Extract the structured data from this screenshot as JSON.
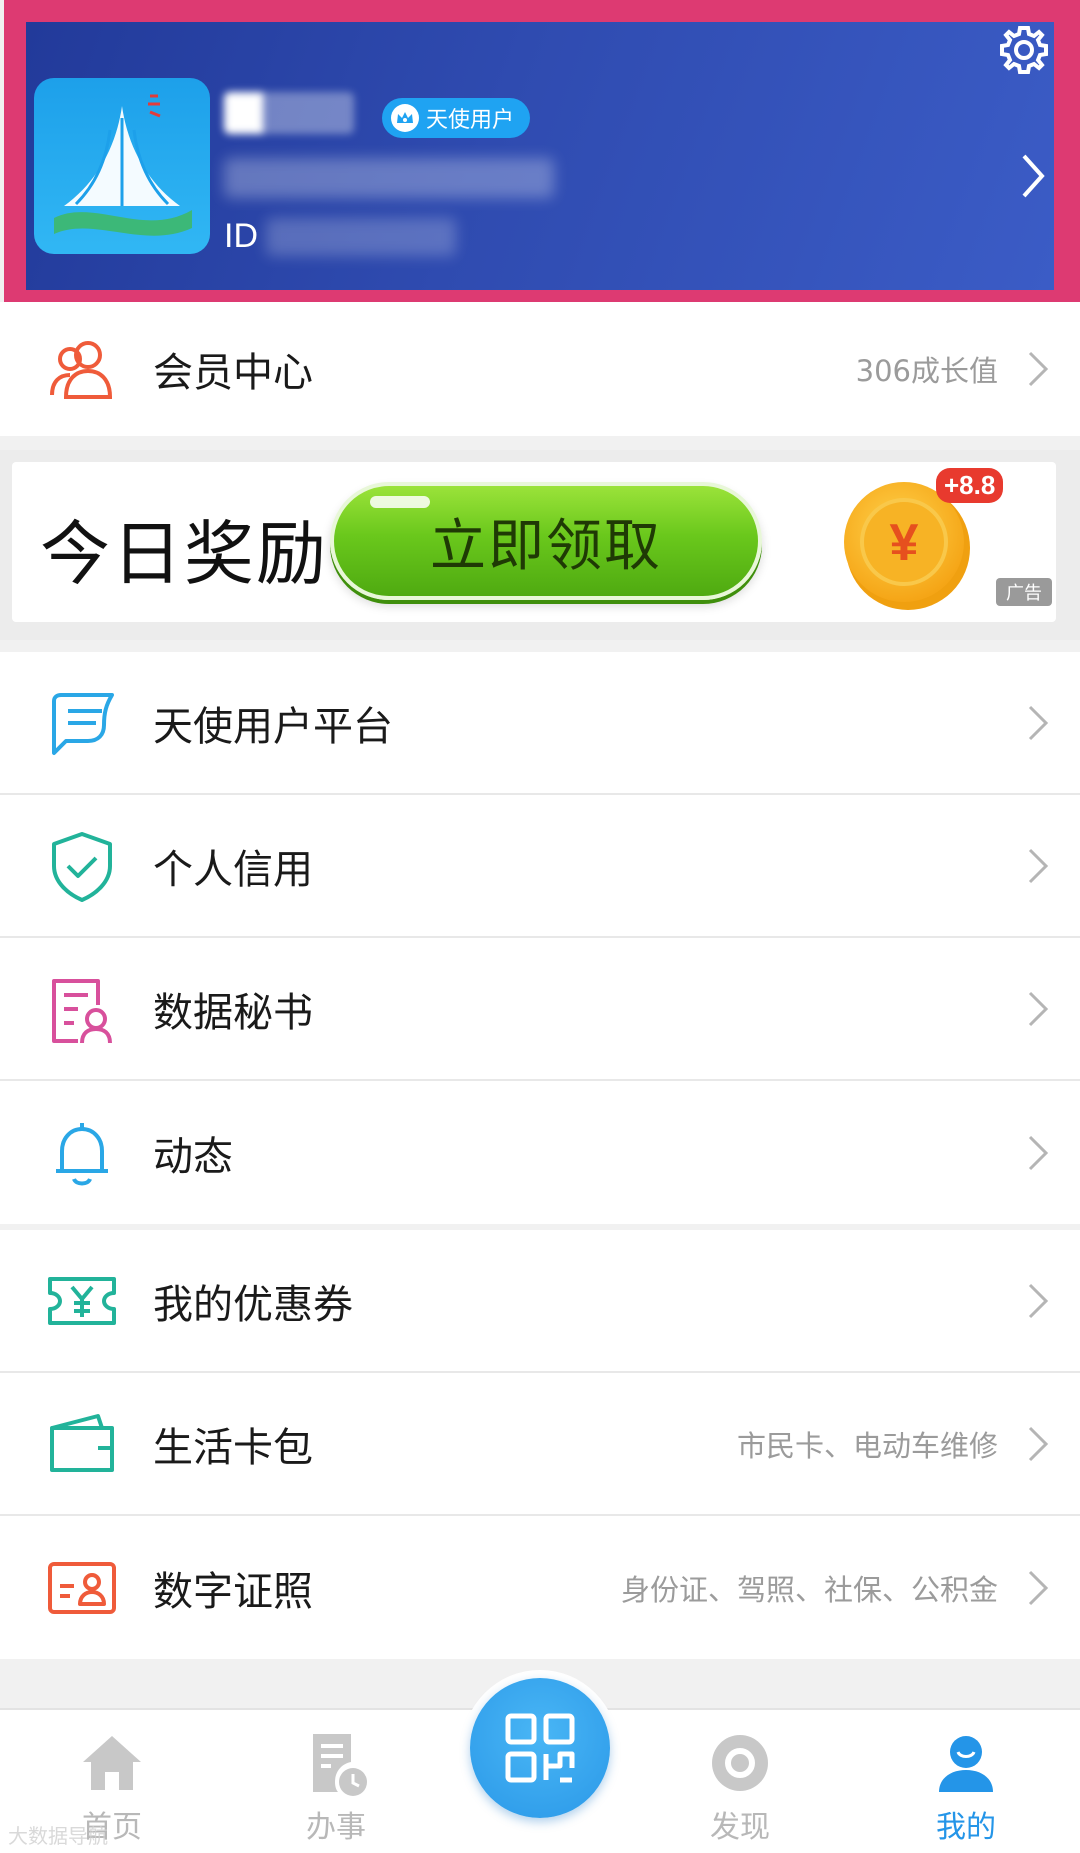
{
  "profile": {
    "badge_label": "天使用户",
    "id_label": "ID"
  },
  "member_center": {
    "label": "会员中心",
    "hint": "306成长值"
  },
  "ad": {
    "title": "今日奖励",
    "button_label": "立即领取",
    "coin_symbol": "¥",
    "coin_bonus": "+8.8",
    "tag": "广告"
  },
  "menu_group_1": [
    {
      "label": "天使用户平台",
      "icon": "chat-bubble-icon",
      "color": "#2aa7e6"
    },
    {
      "label": "个人信用",
      "icon": "shield-check-icon",
      "color": "#22b39a"
    },
    {
      "label": "数据秘书",
      "icon": "document-user-icon",
      "color": "#d8509c"
    },
    {
      "label": "动态",
      "icon": "bell-icon",
      "color": "#2aa7e6"
    }
  ],
  "menu_group_2": [
    {
      "label": "我的优惠券",
      "hint": "",
      "icon": "coupon-icon",
      "color": "#22b39a"
    },
    {
      "label": "生活卡包",
      "hint": "市民卡、电动车维修",
      "icon": "wallet-icon",
      "color": "#22b39a"
    },
    {
      "label": "数字证照",
      "hint": "身份证、驾照、社保、公积金",
      "icon": "id-card-icon",
      "color": "#ef5b3a"
    }
  ],
  "tabbar": {
    "items": [
      {
        "label": "首页",
        "icon": "home-icon",
        "active": false
      },
      {
        "label": "办事",
        "icon": "document-clock-icon",
        "active": false
      },
      {
        "label": "发现",
        "icon": "discover-icon",
        "active": false
      },
      {
        "label": "我的",
        "icon": "user-icon",
        "active": true
      }
    ],
    "active_color": "#2495e8",
    "inactive_color": "#b8b8b8"
  },
  "watermark": "大数据导航",
  "colors": {
    "header_gradient_start": "#223a9a",
    "header_gradient_end": "#3b5cc6",
    "frame_highlight": "#dd3a72",
    "badge": "#1fa3f2",
    "accent": "#2495e8"
  }
}
